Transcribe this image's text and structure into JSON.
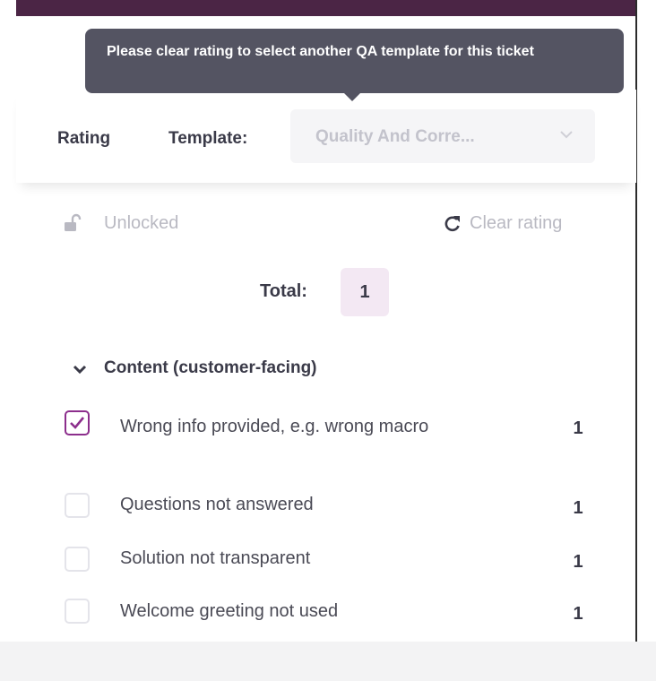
{
  "tooltip": {
    "text": "Please clear rating to select another QA template for this ticket"
  },
  "header": {
    "rating_label": "Rating",
    "template_label": "Template:",
    "template_value": "Quality And Corre...",
    "chevron_icon": "chevron-down-icon"
  },
  "status": {
    "lock_label": "Unlocked",
    "lock_icon": "unlock-icon",
    "clear_label": "Clear rating",
    "clear_icon": "refresh-icon"
  },
  "total": {
    "label": "Total:",
    "value": "1"
  },
  "section": {
    "label": "Content (customer-facing)",
    "icon": "chevron-down-icon"
  },
  "items": [
    {
      "label": "Wrong info provided, e.g. wrong macro",
      "score": "1",
      "checked": true
    },
    {
      "label": "Questions not answered",
      "score": "1",
      "checked": false
    },
    {
      "label": "Solution not transparent",
      "score": "1",
      "checked": false
    },
    {
      "label": "Welcome greeting not used",
      "score": "1",
      "checked": false
    }
  ],
  "colors": {
    "accent": "#8c2e8c",
    "topbar": "#4b2545",
    "tooltip_bg": "#545462",
    "total_bg": "#f3e8f3"
  }
}
